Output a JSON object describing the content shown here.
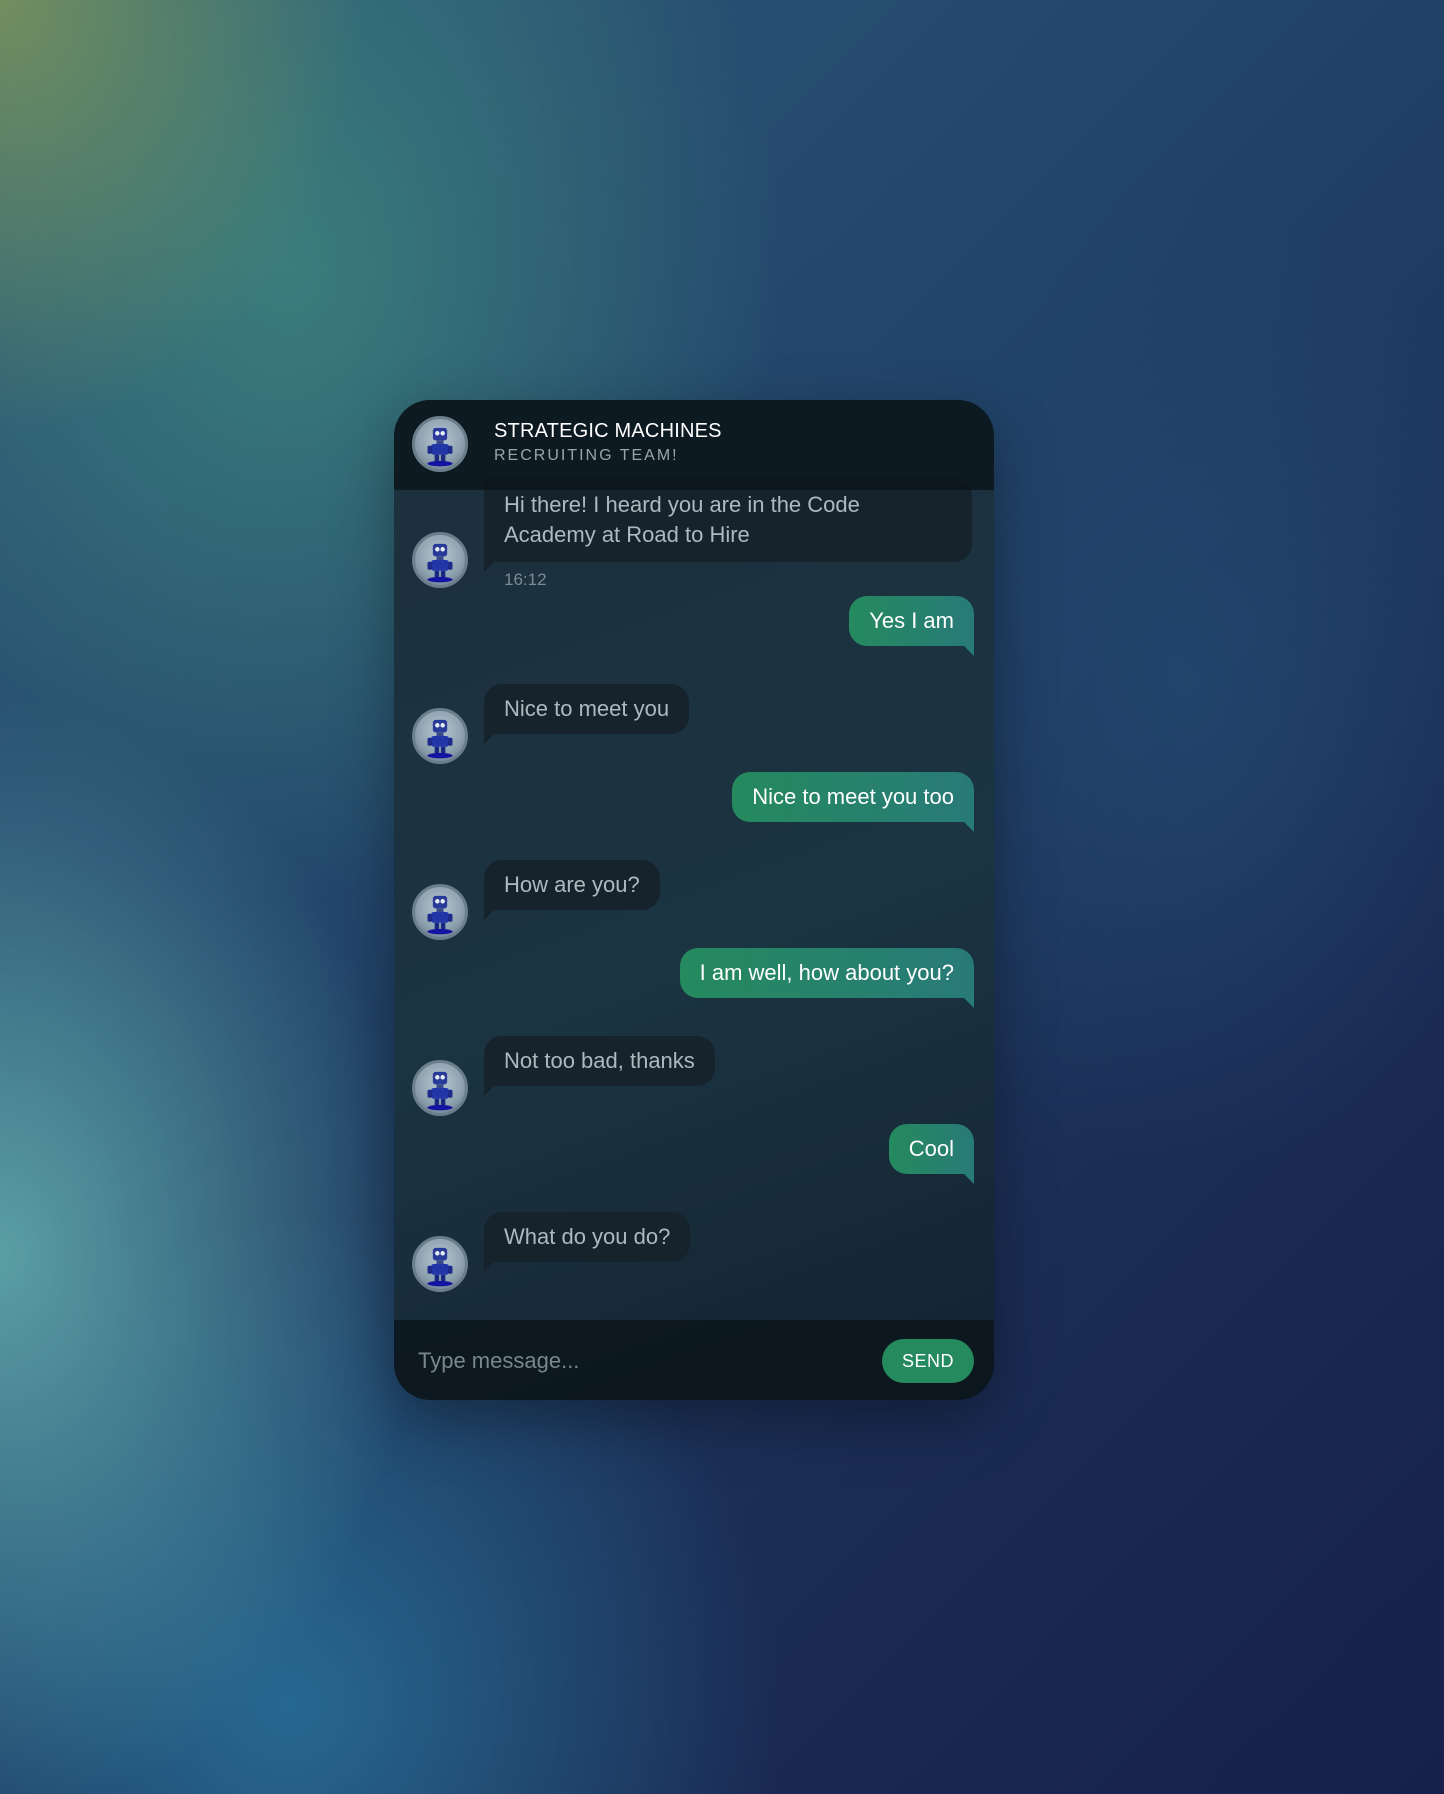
{
  "header": {
    "title": "STRATEGIC MACHINES",
    "subtitle": "RECRUITING TEAM!",
    "avatar_icon": "robot-icon"
  },
  "messages": [
    {
      "from": "bot",
      "text": "Hi there! I heard you are in the Code Academy at Road to Hire",
      "time": "16:12"
    },
    {
      "from": "me",
      "text": "Yes I am"
    },
    {
      "from": "bot",
      "text": "Nice to meet you"
    },
    {
      "from": "me",
      "text": "Nice to meet you too"
    },
    {
      "from": "bot",
      "text": "How are you?"
    },
    {
      "from": "me",
      "text": "I am well, how about you?"
    },
    {
      "from": "bot",
      "text": "Not too bad, thanks"
    },
    {
      "from": "me",
      "text": "Cool"
    },
    {
      "from": "bot",
      "text": "What do you do?"
    }
  ],
  "input": {
    "placeholder": "Type message...",
    "value": ""
  },
  "send_button": {
    "label": "SEND"
  },
  "colors": {
    "bot_bubble": "#16232d",
    "user_bubble_start": "#258a5e",
    "user_bubble_end": "#287a78",
    "send_button": "#258a5e"
  }
}
